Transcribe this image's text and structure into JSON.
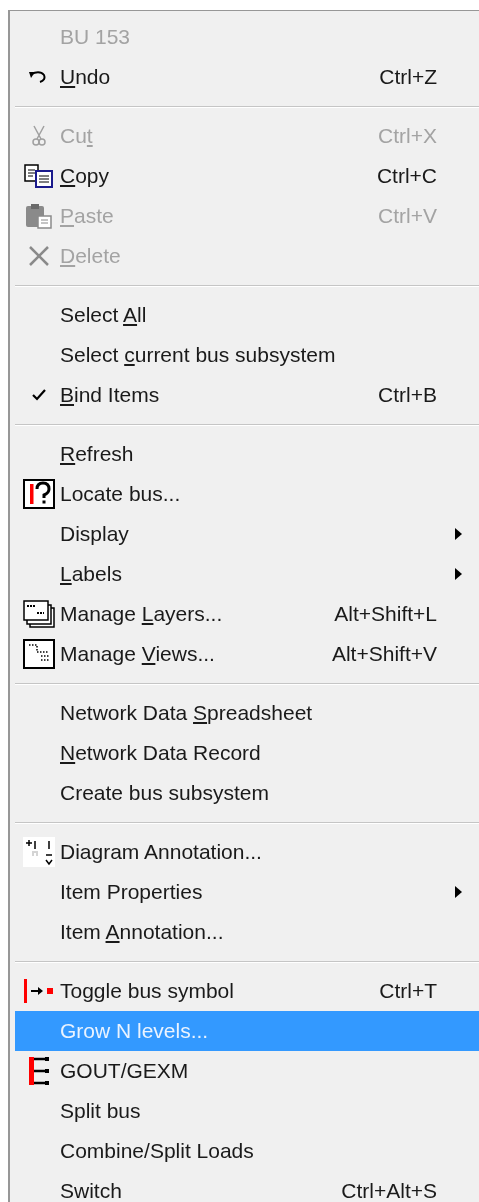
{
  "menu": {
    "sections": [
      [
        {
          "label": {
            "after": "BU  153"
          },
          "disabled": true,
          "selected": false,
          "checked": false,
          "submenu": false
        },
        {
          "label": {
            "key": "U",
            "after": "ndo"
          },
          "shortcut": "Ctrl+Z",
          "kind": "undo",
          "disabled": false,
          "selected": false,
          "checked": false,
          "submenu": false
        }
      ],
      [
        {
          "label": {
            "before": "Cu",
            "key": "t"
          },
          "shortcut": "Ctrl+X",
          "kind": "cut",
          "disabled": true,
          "selected": false,
          "checked": false,
          "submenu": false
        },
        {
          "label": {
            "key": "C",
            "after": "opy"
          },
          "shortcut": "Ctrl+C",
          "kind": "copy",
          "disabled": false,
          "selected": false,
          "checked": false,
          "submenu": false
        },
        {
          "label": {
            "key": "P",
            "after": "aste"
          },
          "shortcut": "Ctrl+V",
          "kind": "paste",
          "disabled": true,
          "selected": false,
          "checked": false,
          "submenu": false
        },
        {
          "label": {
            "key": "D",
            "after": "elete"
          },
          "kind": "delete",
          "disabled": true,
          "selected": false,
          "checked": false,
          "submenu": false
        }
      ],
      [
        {
          "label": {
            "before": "Select ",
            "key": "A",
            "after": "ll"
          },
          "disabled": false,
          "selected": false,
          "checked": false,
          "submenu": false
        },
        {
          "label": {
            "before": "Select ",
            "key": "c",
            "after": "urrent bus subsystem"
          },
          "disabled": false,
          "selected": false,
          "checked": false,
          "submenu": false
        },
        {
          "label": {
            "key": "B",
            "after": "ind Items"
          },
          "shortcut": "Ctrl+B",
          "disabled": false,
          "selected": false,
          "checked": true,
          "submenu": false
        }
      ],
      [
        {
          "label": {
            "key": "R",
            "after": "efresh"
          },
          "disabled": false,
          "selected": false,
          "checked": false,
          "submenu": false
        },
        {
          "label": {
            "after": "Locate bus..."
          },
          "kind": "locate",
          "disabled": false,
          "selected": false,
          "checked": false,
          "submenu": false
        },
        {
          "label": {
            "after": "Display"
          },
          "disabled": false,
          "selected": false,
          "checked": false,
          "submenu": true
        },
        {
          "label": {
            "key": "L",
            "after": "abels"
          },
          "disabled": false,
          "selected": false,
          "checked": false,
          "submenu": true
        },
        {
          "label": {
            "before": "Manage ",
            "key": "L",
            "after": "ayers..."
          },
          "shortcut": "Alt+Shift+L",
          "kind": "layers",
          "disabled": false,
          "selected": false,
          "checked": false,
          "submenu": false
        },
        {
          "label": {
            "before": "Manage ",
            "key": "V",
            "after": "iews..."
          },
          "shortcut": "Alt+Shift+V",
          "kind": "views",
          "disabled": false,
          "selected": false,
          "checked": false,
          "submenu": false
        }
      ],
      [
        {
          "label": {
            "before": "Network Data ",
            "key": "S",
            "after": "preadsheet"
          },
          "disabled": false,
          "selected": false,
          "checked": false,
          "submenu": false
        },
        {
          "label": {
            "key": "N",
            "after": "etwork Data Record"
          },
          "disabled": false,
          "selected": false,
          "checked": false,
          "submenu": false
        },
        {
          "label": {
            "after": "Create bus subsystem"
          },
          "disabled": false,
          "selected": false,
          "checked": false,
          "submenu": false
        }
      ],
      [
        {
          "label": {
            "after": "Diagram Annotation..."
          },
          "kind": "annotation",
          "disabled": false,
          "selected": false,
          "checked": false,
          "submenu": false
        },
        {
          "label": {
            "after": "Item Properties"
          },
          "disabled": false,
          "selected": false,
          "checked": false,
          "submenu": true
        },
        {
          "label": {
            "before": "Item ",
            "key": "A",
            "after": "nnotation..."
          },
          "disabled": false,
          "selected": false,
          "checked": false,
          "submenu": false
        }
      ],
      [
        {
          "label": {
            "after": "Toggle bus symbol"
          },
          "shortcut": "Ctrl+T",
          "kind": "toggle",
          "disabled": false,
          "selected": false,
          "checked": false,
          "submenu": false
        },
        {
          "label": {
            "after": "Grow N levels..."
          },
          "disabled": false,
          "selected": true,
          "checked": false,
          "submenu": false
        },
        {
          "label": {
            "after": "GOUT/GEXM"
          },
          "kind": "gout",
          "disabled": false,
          "selected": false,
          "checked": false,
          "submenu": false
        },
        {
          "label": {
            "after": "Split bus"
          },
          "disabled": false,
          "selected": false,
          "checked": false,
          "submenu": false
        },
        {
          "label": {
            "after": "Combine/Split Loads"
          },
          "disabled": false,
          "selected": false,
          "checked": false,
          "submenu": false
        },
        {
          "label": {
            "after": "Switch"
          },
          "shortcut": "Ctrl+Alt+S",
          "disabled": false,
          "selected": false,
          "checked": false,
          "submenu": false
        }
      ]
    ]
  }
}
